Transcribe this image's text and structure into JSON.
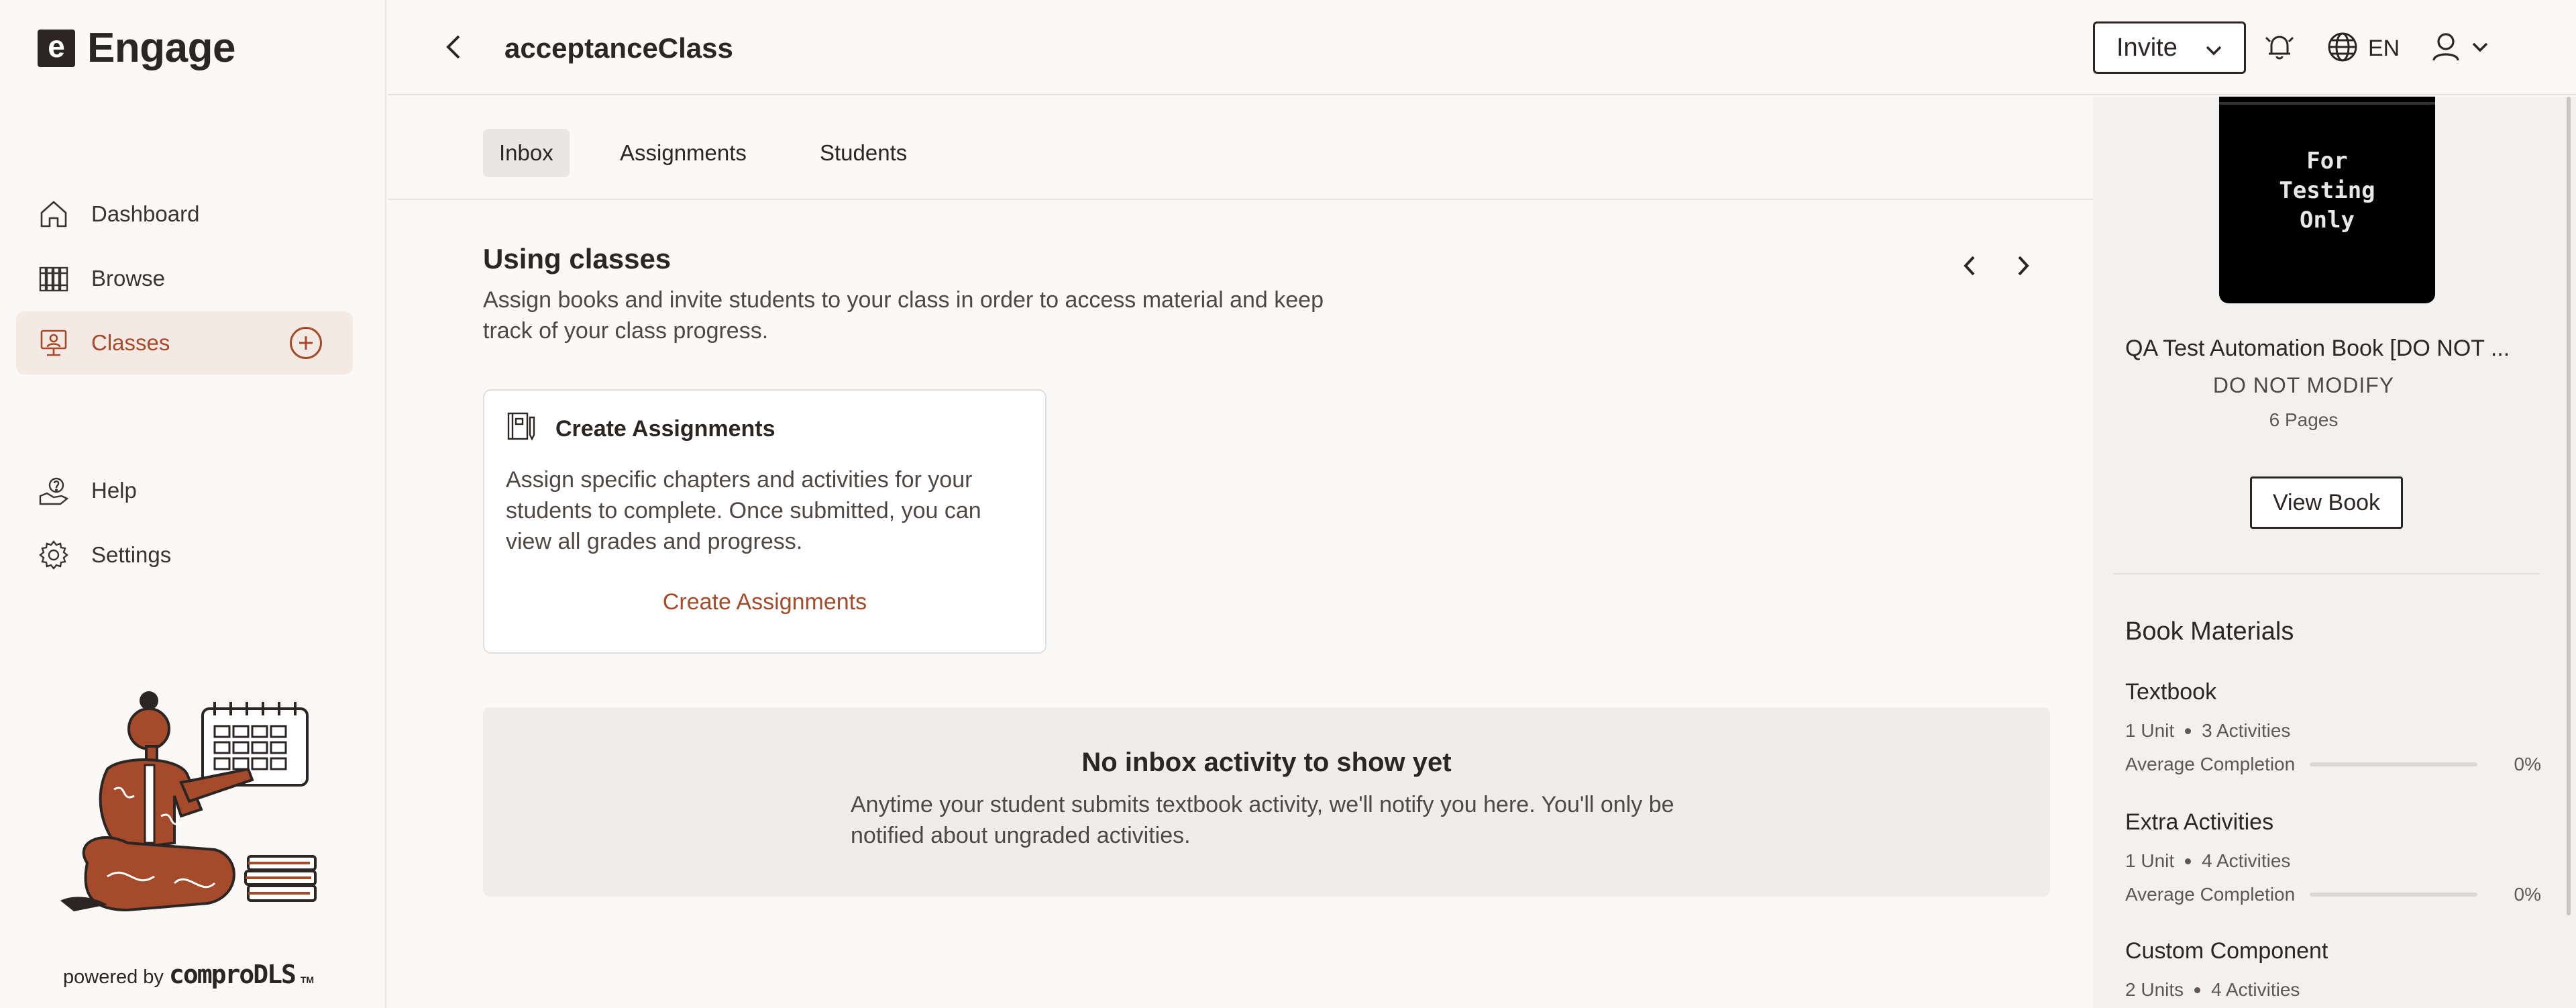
{
  "app": {
    "name": "Engage",
    "logo_letter": "e"
  },
  "sidebar": {
    "items": [
      {
        "label": "Dashboard",
        "icon": "home-icon"
      },
      {
        "label": "Browse",
        "icon": "books-icon"
      },
      {
        "label": "Classes",
        "icon": "classroom-icon",
        "active": true
      },
      {
        "label": "Help",
        "icon": "help-icon"
      },
      {
        "label": "Settings",
        "icon": "gear-icon"
      }
    ],
    "powered_prefix": "powered by",
    "powered_brand": "comproDLS",
    "powered_tm": "TM"
  },
  "header": {
    "title": "acceptanceClass",
    "invite_label": "Invite",
    "language": "EN"
  },
  "tabs": [
    {
      "label": "Inbox",
      "active": true
    },
    {
      "label": "Assignments"
    },
    {
      "label": "Students"
    }
  ],
  "using_classes": {
    "title": "Using classes",
    "description": "Assign books and invite students to your class in order to access material and keep track of your class progress."
  },
  "card": {
    "title": "Create Assignments",
    "body": "Assign specific chapters and activities for your students to complete. Once submitted, you can view all grades and progress.",
    "link": "Create Assignments"
  },
  "empty_state": {
    "title": "No inbox activity to show yet",
    "description": "Anytime your student submits textbook activity, we'll notify you here. You'll only be notified about ungraded activities."
  },
  "book": {
    "cover_text": "For\nTesting\nOnly",
    "title": "QA Test Automation Book [DO NOT ...",
    "subtitle": "DO NOT MODIFY",
    "pages": "6 Pages",
    "view_label": "View Book"
  },
  "materials": {
    "heading": "Book Materials",
    "items": [
      {
        "name": "Textbook",
        "units": "1 Unit",
        "activities": "3 Activities",
        "completion_label": "Average Completion",
        "completion": 0,
        "completion_text": "0%"
      },
      {
        "name": "Extra Activities",
        "units": "1 Unit",
        "activities": "4 Activities",
        "completion_label": "Average Completion",
        "completion": 0,
        "completion_text": "0%"
      },
      {
        "name": "Custom Component",
        "units": "2 Units",
        "activities": "4 Activities"
      }
    ]
  },
  "colors": {
    "accent": "#a54a2a",
    "text": "#2b2624",
    "active_bg": "#f5e9e4"
  }
}
